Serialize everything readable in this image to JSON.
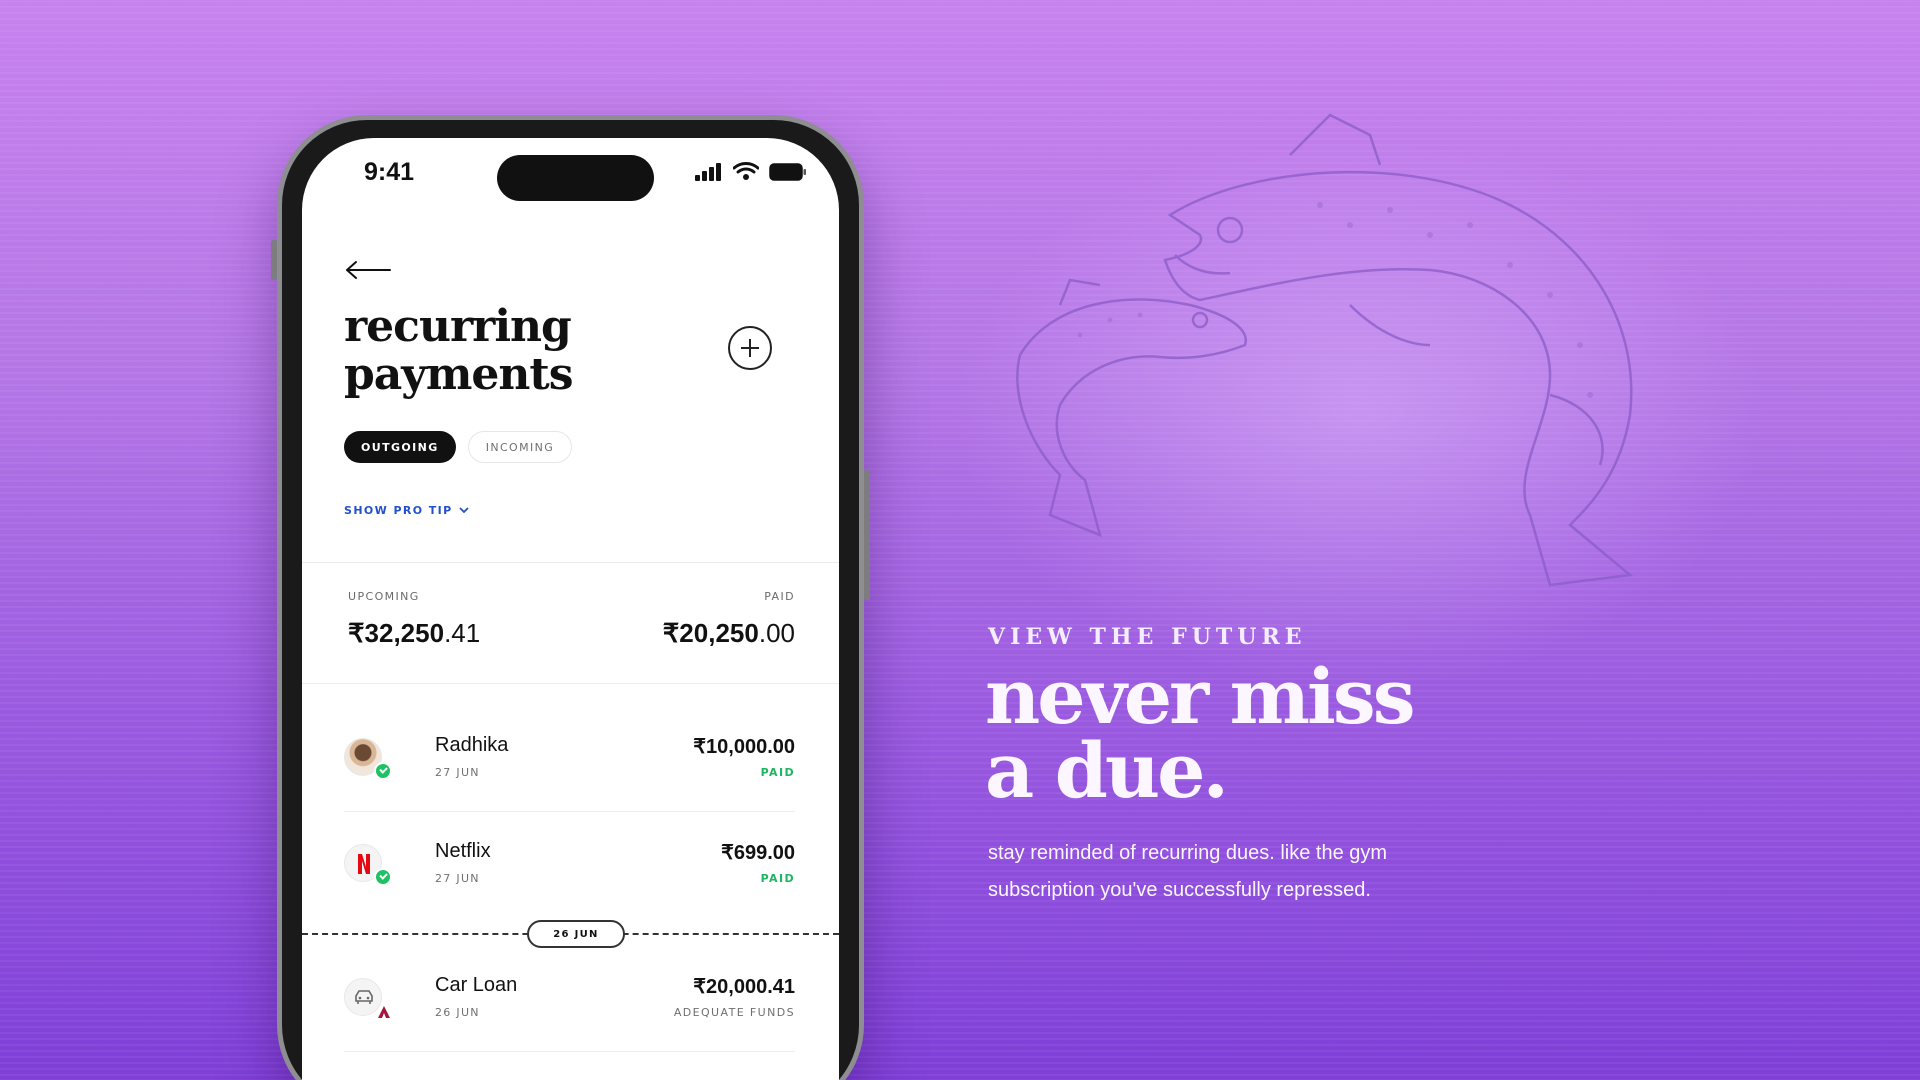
{
  "status_bar": {
    "time": "9:41",
    "icons": [
      "signal-icon",
      "wifi-icon",
      "battery-icon"
    ]
  },
  "header": {
    "back_icon": "back-arrow-icon",
    "title_line1": "recurring",
    "title_line2": "payments",
    "add_icon": "plus-circle-icon"
  },
  "tabs": [
    {
      "label": "OUTGOING",
      "active": true
    },
    {
      "label": "INCOMING",
      "active": false
    }
  ],
  "pro_tip": {
    "label": "SHOW PRO TIP",
    "icon": "chevron-down-icon"
  },
  "summary": {
    "upcoming_label": "UPCOMING",
    "upcoming_whole": "₹32,250",
    "upcoming_decimal": ".41",
    "paid_label": "PAID",
    "paid_whole": "₹20,250",
    "paid_decimal": ".00"
  },
  "payments": [
    {
      "name": "Radhika",
      "date": "27 JUN",
      "amount": "₹10,000.00",
      "status": "PAID",
      "icon": "user-avatar"
    },
    {
      "name": "Netflix",
      "date": "27 JUN",
      "amount": "₹699.00",
      "status": "PAID",
      "icon": "netflix-logo"
    },
    {
      "name": "Car Loan",
      "date": "26 JUN",
      "amount": "₹20,000.41",
      "status": "ADEQUATE FUNDS",
      "icon": "car-icon"
    }
  ],
  "date_marker": "26 JUN",
  "promo": {
    "eyebrow": "VIEW THE FUTURE",
    "headline_line1": "never miss",
    "headline_line2": "a due.",
    "body": "stay reminded of recurring dues. like the gym subscription you've successfully repressed."
  },
  "colors": {
    "background_top": "#c782ee",
    "background_bottom": "#7f3fd8",
    "paid_green": "#20b562",
    "link_blue": "#2451c9"
  }
}
